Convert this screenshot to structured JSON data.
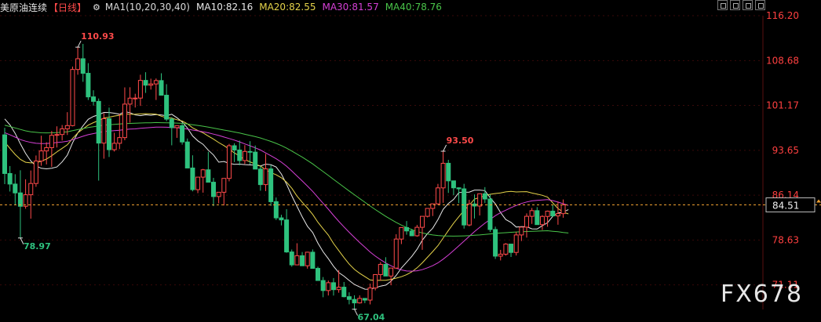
{
  "header": {
    "instrument": "美原油连续",
    "period": "【日线】",
    "indicators": [
      {
        "label": "MA1(10,20,30,40)",
        "color": "#d9d9d9"
      },
      {
        "label": "MA10:82.16",
        "color": "#e8e8e8"
      },
      {
        "label": "MA20:82.55",
        "color": "#e5d34a"
      },
      {
        "label": "MA30:81.57",
        "color": "#d640d6"
      },
      {
        "label": "MA40:78.76",
        "color": "#49c449"
      }
    ]
  },
  "watermark": "FX678",
  "colors": {
    "up": "#ff4a4a",
    "down": "#2ec27e",
    "grid": "#3a0a0a",
    "axis_text": "#ff4040",
    "current": "#f0a030"
  },
  "chart_data": {
    "type": "candlestick",
    "ylim": [
      67.0,
      116.2
    ],
    "y_ticks": [
      "116.20",
      "108.68",
      "101.17",
      "93.65",
      "86.14",
      "78.63",
      "71.11"
    ],
    "current_price": "84.51",
    "annotations": [
      {
        "label": "110.93",
        "value": 110.93,
        "index": 14
      },
      {
        "label": "78.97",
        "value": 78.97,
        "index": 3
      },
      {
        "label": "93.50",
        "value": 93.5,
        "index": 84
      },
      {
        "label": "67.04",
        "value": 67.04,
        "index": 67
      }
    ],
    "candles": [
      [
        96.24,
        97.43,
        87.99,
        89.77
      ],
      [
        89.77,
        91.02,
        86.75,
        88.0
      ],
      [
        88.0,
        89.65,
        84.52,
        86.52
      ],
      [
        86.52,
        90.31,
        78.97,
        84.28
      ],
      [
        84.28,
        88.8,
        83.87,
        86.21
      ],
      [
        86.21,
        90.27,
        82.2,
        88.1
      ],
      [
        88.1,
        92.79,
        87.54,
        91.86
      ],
      [
        91.86,
        96.1,
        91.07,
        93.55
      ],
      [
        93.55,
        95.0,
        91.29,
        94.1
      ],
      [
        94.1,
        96.89,
        90.88,
        96.16
      ],
      [
        96.16,
        97.67,
        94.12,
        96.3
      ],
      [
        96.3,
        97.89,
        95.29,
        97.25
      ],
      [
        97.25,
        100.04,
        96.22,
        97.79
      ],
      [
        97.79,
        107.68,
        97.66,
        107.19
      ],
      [
        107.19,
        110.93,
        106.31,
        108.99
      ],
      [
        108.99,
        111.47,
        105.12,
        106.55
      ],
      [
        106.55,
        108.25,
        102.08,
        102.6
      ],
      [
        102.6,
        103.71,
        101.14,
        101.85
      ],
      [
        101.85,
        102.33,
        88.58,
        94.86
      ],
      [
        94.86,
        99.86,
        92.25,
        98.95
      ],
      [
        98.95,
        100.8,
        92.53,
        93.76
      ],
      [
        93.76,
        96.59,
        93.45,
        94.83
      ],
      [
        94.83,
        99.76,
        93.86,
        95.78
      ],
      [
        95.78,
        104.19,
        95.34,
        101.39
      ],
      [
        101.39,
        104.21,
        98.29,
        102.39
      ],
      [
        102.39,
        103.12,
        100.82,
        102.4
      ],
      [
        102.4,
        106.31,
        101.09,
        105.36
      ],
      [
        105.36,
        106.73,
        103.27,
        104.56
      ],
      [
        104.56,
        105.65,
        103.82,
        104.77
      ],
      [
        104.77,
        105.68,
        102.08,
        105.33
      ],
      [
        105.33,
        106.56,
        103.04,
        102.88
      ],
      [
        102.88,
        104.73,
        98.53,
        98.87
      ],
      [
        98.87,
        99.19,
        94.49,
        97.45
      ],
      [
        97.45,
        97.8,
        95.74,
        97.78
      ],
      [
        97.78,
        98.2,
        94.6,
        95.05
      ],
      [
        95.05,
        95.63,
        91.57,
        90.69
      ],
      [
        90.69,
        92.82,
        86.78,
        87.07
      ],
      [
        87.07,
        88.46,
        86.48,
        89.16
      ],
      [
        89.16,
        90.54,
        86.56,
        90.39
      ],
      [
        90.39,
        93.41,
        88.63,
        88.31
      ],
      [
        88.31,
        89.04,
        84.3,
        85.91
      ],
      [
        85.91,
        86.47,
        84.76,
        86.63
      ],
      [
        86.63,
        88.82,
        84.42,
        88.95
      ],
      [
        88.95,
        94.73,
        88.46,
        94.42
      ],
      [
        94.42,
        94.83,
        91.69,
        93.7
      ],
      [
        93.7,
        95.28,
        91.15,
        91.94
      ],
      [
        91.94,
        94.52,
        91.37,
        93.46
      ],
      [
        93.46,
        95.18,
        91.3,
        93.35
      ],
      [
        93.35,
        94.46,
        91.49,
        90.51
      ],
      [
        90.51,
        91.02,
        86.89,
        87.91
      ],
      [
        87.91,
        93.06,
        86.82,
        90.54
      ],
      [
        90.54,
        91.16,
        84.35,
        85.05
      ],
      [
        85.05,
        85.75,
        81.98,
        82.34
      ],
      [
        82.34,
        82.86,
        81.08,
        82.0
      ],
      [
        82.0,
        83.79,
        76.49,
        76.63
      ],
      [
        76.63,
        77.04,
        74.16,
        74.47
      ],
      [
        74.47,
        78.09,
        74.46,
        76.0
      ],
      [
        76.0,
        76.62,
        74.46,
        74.32
      ],
      [
        74.32,
        76.66,
        73.84,
        76.59
      ],
      [
        76.59,
        77.05,
        74.77,
        73.88
      ],
      [
        73.88,
        74.16,
        72.53,
        71.85
      ],
      [
        71.85,
        72.43,
        69.05,
        70.17
      ],
      [
        70.17,
        71.84,
        69.34,
        71.48
      ],
      [
        71.48,
        72.26,
        69.33,
        70.32
      ],
      [
        70.32,
        73.6,
        69.8,
        70.73
      ],
      [
        70.73,
        71.6,
        69.02,
        69.14
      ],
      [
        69.14,
        69.87,
        67.86,
        68.68
      ],
      [
        68.68,
        69.38,
        67.04,
        68.1
      ],
      [
        68.1,
        69.36,
        67.99,
        68.85
      ],
      [
        68.85,
        68.87,
        68.06,
        68.57
      ],
      [
        68.57,
        71.33,
        67.86,
        70.6
      ],
      [
        70.6,
        72.61,
        70.2,
        72.84
      ],
      [
        72.84,
        74.94,
        71.81,
        74.55
      ],
      [
        74.55,
        75.75,
        72.88,
        72.6
      ],
      [
        72.6,
        72.96,
        71.06,
        73.93
      ],
      [
        73.93,
        79.6,
        73.79,
        78.79
      ],
      [
        78.79,
        80.09,
        77.95,
        80.72
      ],
      [
        80.72,
        81.81,
        79.52,
        80.15
      ],
      [
        80.15,
        80.49,
        79.3,
        79.34
      ],
      [
        79.34,
        81.16,
        79.18,
        80.76
      ],
      [
        80.76,
        82.4,
        76.98,
        82.6
      ],
      [
        82.6,
        83.51,
        82.42,
        83.92
      ],
      [
        83.92,
        84.58,
        82.65,
        84.69
      ],
      [
        84.69,
        88.03,
        84.53,
        87.36
      ],
      [
        87.36,
        93.5,
        84.86,
        91.48
      ],
      [
        91.48,
        92.05,
        86.51,
        88.54
      ],
      [
        88.54,
        87.85,
        86.14,
        87.37
      ],
      [
        87.37,
        87.45,
        84.79,
        87.2
      ],
      [
        87.2,
        88.04,
        80.54,
        81.15
      ],
      [
        81.15,
        85.36,
        80.93,
        84.67
      ],
      [
        84.67,
        86.27,
        82.24,
        84.32
      ],
      [
        84.32,
        85.98,
        82.74,
        86.38
      ],
      [
        86.38,
        87.49,
        84.83,
        85.5
      ],
      [
        85.5,
        86.27,
        79.98,
        80.39
      ],
      [
        80.39,
        80.87,
        75.46,
        75.93
      ],
      [
        75.93,
        76.98,
        75.21,
        76.26
      ],
      [
        76.26,
        78.11,
        76.01,
        77.95
      ],
      [
        77.95,
        77.95,
        75.79,
        76.55
      ],
      [
        76.55,
        80.0,
        76.04,
        79.48
      ],
      [
        79.48,
        80.2,
        78.46,
        80.79
      ],
      [
        80.79,
        83.09,
        79.03,
        82.6
      ],
      [
        82.6,
        84.0,
        81.33,
        83.55
      ],
      [
        83.55,
        84.14,
        81.94,
        81.21
      ],
      [
        81.21,
        82.79,
        80.3,
        82.58
      ],
      [
        82.58,
        83.56,
        80.85,
        83.46
      ],
      [
        83.46,
        84.54,
        82.49,
        82.67
      ],
      [
        82.67,
        85.06,
        81.19,
        83.05
      ],
      [
        83.05,
        85.42,
        82.36,
        84.51
      ]
    ],
    "ma": [
      {
        "name": "MA10",
        "color": "#e8e8e8",
        "values": [
          98.91,
          97.91,
          96.49,
          94.74,
          93.14,
          91.86,
          91.03,
          90.64,
          90.55,
          90.66,
          90.87,
          91.72,
          92.85,
          94.92,
          96.57,
          97.75,
          98.84,
          99.33,
          99.62,
          100.0,
          99.99,
          99.86,
          99.7,
          100.13,
          99.96,
          99.58,
          99.46,
          99.6,
          99.52,
          99.64,
          99.57,
          99.45,
          99.69,
          99.11,
          98.41,
          97.38,
          96.06,
          95.24,
          94.66,
          93.67,
          92.87,
          91.67,
          91.79,
          91.47,
          91.31,
          91.34,
          91.26,
          91.21,
          91.17,
          91.04,
          91.34,
          91.23,
          90.85,
          89.68,
          87.97,
          86.03,
          84.26,
          82.5,
          80.94,
          79.89,
          78.13,
          76.65,
          75.5,
          74.23,
          73.18,
          72.57,
          71.85,
          71.19,
          70.78,
          70.4,
          70.38,
          70.64,
          70.91,
          71.08,
          71.72,
          72.71,
          73.94,
          74.91,
          75.89,
          77.09,
          78.59,
          79.7,
          80.61,
          82.06,
          83.77,
          84.75,
          85.44,
          86.58,
          86.63,
          86.65,
          87.0,
          87.0,
          86.9,
          85.69,
          84.68,
          83.21,
          82.06,
          81.58,
          80.8,
          80.88,
          80.85,
          80.5,
          80.48,
          81.02,
          81.53,
          82.61,
          83.14,
          83.32,
          83.71
        ],
        "start": 0
      },
      {
        "name": "MA20",
        "color": "#e5d34a",
        "values": [
          95.04,
          93.97,
          92.97,
          92.12,
          91.65,
          91.55,
          91.58,
          91.82,
          92.19,
          92.74,
          93.38,
          93.99,
          94.58,
          95.64,
          96.57,
          97.24,
          97.87,
          98.29,
          98.63,
          99.06,
          99.19,
          99.39,
          99.53,
          99.78,
          99.68,
          99.69,
          99.75,
          99.79,
          99.75,
          99.69,
          99.37,
          99.11,
          99.04,
          98.78,
          98.55,
          98.08,
          97.41,
          96.96,
          96.57,
          96.04,
          95.52,
          94.95,
          94.45,
          93.84,
          93.21,
          92.69,
          92.07,
          91.73,
          91.32,
          91.01,
          90.41,
          89.92,
          89.55,
          89.05,
          88.32,
          87.3,
          85.99,
          84.95,
          83.99,
          82.92,
          81.61,
          80.5,
          79.47,
          78.03,
          76.87,
          75.69,
          74.59,
          73.71,
          73.06,
          72.5,
          71.94,
          71.86,
          71.89,
          71.9,
          72.04,
          72.25,
          72.49,
          72.82,
          73.3,
          73.98,
          74.81,
          75.74,
          76.7,
          77.69,
          78.95,
          80.22,
          81.44,
          82.54,
          83.58,
          84.46,
          85.47,
          85.76,
          86.05,
          86.28,
          86.42,
          86.51,
          86.69,
          86.78,
          86.68,
          86.7,
          86.73,
          86.49,
          86.31,
          86.12,
          85.83,
          84.84,
          83.91,
          83.3,
          83.0
        ],
        "start": 0
      },
      {
        "name": "MA30",
        "color": "#d640d6",
        "values": [
          96.61,
          96.25,
          95.86,
          95.45,
          95.18,
          94.97,
          94.83,
          94.78,
          94.8,
          94.86,
          94.96,
          95.05,
          95.17,
          95.43,
          95.72,
          96.01,
          96.27,
          96.46,
          96.64,
          96.8,
          96.87,
          96.95,
          97.02,
          97.13,
          97.2,
          97.24,
          97.34,
          97.41,
          97.48,
          97.54,
          97.53,
          97.52,
          97.48,
          97.42,
          97.35,
          97.22,
          97.05,
          96.92,
          96.76,
          96.58,
          96.36,
          96.14,
          95.88,
          95.63,
          95.36,
          95.06,
          94.72,
          94.41,
          94.07,
          93.7,
          93.21,
          92.74,
          92.24,
          91.66,
          90.99,
          90.18,
          89.35,
          88.52,
          87.67,
          86.77,
          85.77,
          84.76,
          83.79,
          82.74,
          81.76,
          80.81,
          79.92,
          79.06,
          78.22,
          77.43,
          76.63,
          75.94,
          75.35,
          74.78,
          74.32,
          73.92,
          73.62,
          73.44,
          73.41,
          73.48,
          73.67,
          73.98,
          74.34,
          74.81,
          75.42,
          76.12,
          76.87,
          77.66,
          78.44,
          79.25,
          80.04,
          80.75,
          81.44,
          82.07,
          82.7,
          83.21,
          83.62,
          84.04,
          84.41,
          84.75,
          85.0,
          85.18,
          85.27,
          85.34,
          85.39,
          85.23,
          84.99,
          84.7,
          84.43
        ],
        "start": 0
      },
      {
        "name": "MA40",
        "color": "#49c449",
        "values": [
          97.85,
          97.64,
          97.4,
          97.15,
          96.92,
          96.76,
          96.66,
          96.59,
          96.57,
          96.58,
          96.63,
          96.68,
          96.76,
          96.94,
          97.12,
          97.3,
          97.47,
          97.61,
          97.74,
          97.87,
          97.93,
          97.99,
          98.05,
          98.13,
          98.16,
          98.18,
          98.22,
          98.25,
          98.27,
          98.3,
          98.28,
          98.26,
          98.24,
          98.21,
          98.17,
          98.07,
          97.94,
          97.82,
          97.69,
          97.54,
          97.37,
          97.21,
          97.05,
          96.9,
          96.72,
          96.54,
          96.33,
          96.14,
          95.94,
          95.72,
          95.43,
          95.14,
          94.81,
          94.45,
          94.02,
          93.53,
          93.02,
          92.5,
          91.95,
          91.38,
          90.74,
          90.09,
          89.45,
          88.78,
          88.13,
          87.48,
          86.84,
          86.21,
          85.58,
          84.96,
          84.33,
          83.73,
          83.16,
          82.59,
          82.07,
          81.58,
          81.13,
          80.73,
          80.37,
          80.06,
          79.82,
          79.64,
          79.48,
          79.38,
          79.32,
          79.29,
          79.28,
          79.3,
          79.32,
          79.36,
          79.42,
          79.48,
          79.56,
          79.65,
          79.74,
          79.8,
          79.86,
          79.92,
          79.98,
          80.03,
          80.06,
          80.1,
          80.12,
          80.15,
          80.18,
          80.1,
          80.01,
          79.9,
          79.8
        ],
        "start": 0
      }
    ]
  }
}
